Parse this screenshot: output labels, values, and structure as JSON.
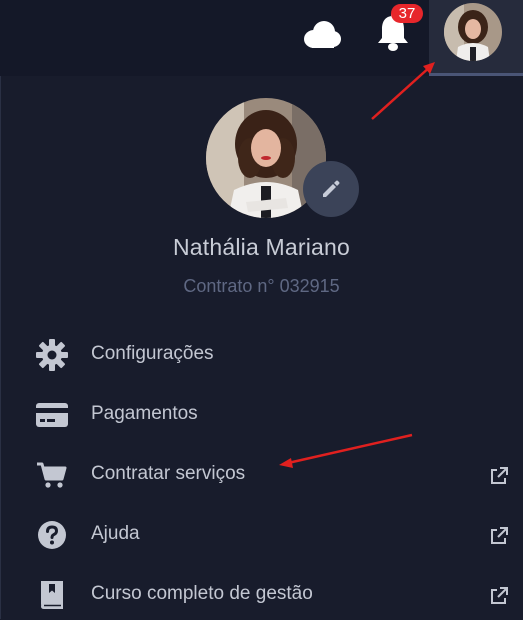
{
  "header": {
    "cloud_icon": "cloud-icon",
    "bell_icon": "bell-icon",
    "notification_count": "37"
  },
  "profile": {
    "name": "Nathália Mariano",
    "contract": "Contrato n° 032915",
    "edit_icon": "pencil-icon"
  },
  "menu": {
    "items": [
      {
        "label": "Configurações",
        "icon": "gear-icon",
        "external": false
      },
      {
        "label": "Pagamentos",
        "icon": "credit-card-icon",
        "external": false
      },
      {
        "label": "Contratar serviços",
        "icon": "cart-icon",
        "external": true
      },
      {
        "label": "Ajuda",
        "icon": "question-circle-icon",
        "external": true
      },
      {
        "label": "Curso completo de gestão",
        "icon": "book-icon",
        "external": true
      }
    ]
  },
  "colors": {
    "background": "#181c2c",
    "topbar": "#141828",
    "badge": "#e7262b",
    "annotation_arrow": "#e0201f"
  }
}
